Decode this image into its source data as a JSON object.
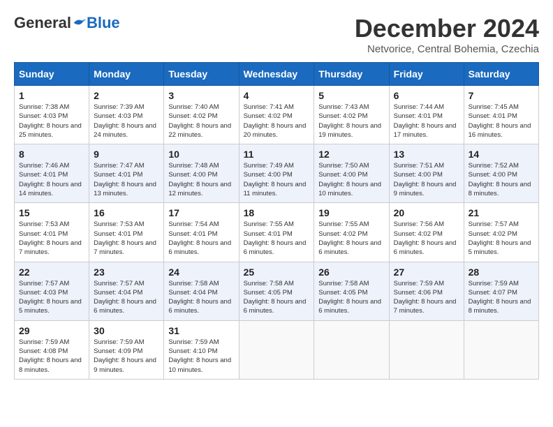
{
  "logo": {
    "general": "General",
    "blue": "Blue"
  },
  "title": "December 2024",
  "subtitle": "Netvorice, Central Bohemia, Czechia",
  "weekdays": [
    "Sunday",
    "Monday",
    "Tuesday",
    "Wednesday",
    "Thursday",
    "Friday",
    "Saturday"
  ],
  "weeks": [
    [
      {
        "day": "1",
        "sunrise": "Sunrise: 7:38 AM",
        "sunset": "Sunset: 4:03 PM",
        "daylight": "Daylight: 8 hours and 25 minutes."
      },
      {
        "day": "2",
        "sunrise": "Sunrise: 7:39 AM",
        "sunset": "Sunset: 4:03 PM",
        "daylight": "Daylight: 8 hours and 24 minutes."
      },
      {
        "day": "3",
        "sunrise": "Sunrise: 7:40 AM",
        "sunset": "Sunset: 4:02 PM",
        "daylight": "Daylight: 8 hours and 22 minutes."
      },
      {
        "day": "4",
        "sunrise": "Sunrise: 7:41 AM",
        "sunset": "Sunset: 4:02 PM",
        "daylight": "Daylight: 8 hours and 20 minutes."
      },
      {
        "day": "5",
        "sunrise": "Sunrise: 7:43 AM",
        "sunset": "Sunset: 4:02 PM",
        "daylight": "Daylight: 8 hours and 19 minutes."
      },
      {
        "day": "6",
        "sunrise": "Sunrise: 7:44 AM",
        "sunset": "Sunset: 4:01 PM",
        "daylight": "Daylight: 8 hours and 17 minutes."
      },
      {
        "day": "7",
        "sunrise": "Sunrise: 7:45 AM",
        "sunset": "Sunset: 4:01 PM",
        "daylight": "Daylight: 8 hours and 16 minutes."
      }
    ],
    [
      {
        "day": "8",
        "sunrise": "Sunrise: 7:46 AM",
        "sunset": "Sunset: 4:01 PM",
        "daylight": "Daylight: 8 hours and 14 minutes."
      },
      {
        "day": "9",
        "sunrise": "Sunrise: 7:47 AM",
        "sunset": "Sunset: 4:01 PM",
        "daylight": "Daylight: 8 hours and 13 minutes."
      },
      {
        "day": "10",
        "sunrise": "Sunrise: 7:48 AM",
        "sunset": "Sunset: 4:00 PM",
        "daylight": "Daylight: 8 hours and 12 minutes."
      },
      {
        "day": "11",
        "sunrise": "Sunrise: 7:49 AM",
        "sunset": "Sunset: 4:00 PM",
        "daylight": "Daylight: 8 hours and 11 minutes."
      },
      {
        "day": "12",
        "sunrise": "Sunrise: 7:50 AM",
        "sunset": "Sunset: 4:00 PM",
        "daylight": "Daylight: 8 hours and 10 minutes."
      },
      {
        "day": "13",
        "sunrise": "Sunrise: 7:51 AM",
        "sunset": "Sunset: 4:00 PM",
        "daylight": "Daylight: 8 hours and 9 minutes."
      },
      {
        "day": "14",
        "sunrise": "Sunrise: 7:52 AM",
        "sunset": "Sunset: 4:00 PM",
        "daylight": "Daylight: 8 hours and 8 minutes."
      }
    ],
    [
      {
        "day": "15",
        "sunrise": "Sunrise: 7:53 AM",
        "sunset": "Sunset: 4:01 PM",
        "daylight": "Daylight: 8 hours and 7 minutes."
      },
      {
        "day": "16",
        "sunrise": "Sunrise: 7:53 AM",
        "sunset": "Sunset: 4:01 PM",
        "daylight": "Daylight: 8 hours and 7 minutes."
      },
      {
        "day": "17",
        "sunrise": "Sunrise: 7:54 AM",
        "sunset": "Sunset: 4:01 PM",
        "daylight": "Daylight: 8 hours and 6 minutes."
      },
      {
        "day": "18",
        "sunrise": "Sunrise: 7:55 AM",
        "sunset": "Sunset: 4:01 PM",
        "daylight": "Daylight: 8 hours and 6 minutes."
      },
      {
        "day": "19",
        "sunrise": "Sunrise: 7:55 AM",
        "sunset": "Sunset: 4:02 PM",
        "daylight": "Daylight: 8 hours and 6 minutes."
      },
      {
        "day": "20",
        "sunrise": "Sunrise: 7:56 AM",
        "sunset": "Sunset: 4:02 PM",
        "daylight": "Daylight: 8 hours and 6 minutes."
      },
      {
        "day": "21",
        "sunrise": "Sunrise: 7:57 AM",
        "sunset": "Sunset: 4:02 PM",
        "daylight": "Daylight: 8 hours and 5 minutes."
      }
    ],
    [
      {
        "day": "22",
        "sunrise": "Sunrise: 7:57 AM",
        "sunset": "Sunset: 4:03 PM",
        "daylight": "Daylight: 8 hours and 5 minutes."
      },
      {
        "day": "23",
        "sunrise": "Sunrise: 7:57 AM",
        "sunset": "Sunset: 4:04 PM",
        "daylight": "Daylight: 8 hours and 6 minutes."
      },
      {
        "day": "24",
        "sunrise": "Sunrise: 7:58 AM",
        "sunset": "Sunset: 4:04 PM",
        "daylight": "Daylight: 8 hours and 6 minutes."
      },
      {
        "day": "25",
        "sunrise": "Sunrise: 7:58 AM",
        "sunset": "Sunset: 4:05 PM",
        "daylight": "Daylight: 8 hours and 6 minutes."
      },
      {
        "day": "26",
        "sunrise": "Sunrise: 7:58 AM",
        "sunset": "Sunset: 4:05 PM",
        "daylight": "Daylight: 8 hours and 6 minutes."
      },
      {
        "day": "27",
        "sunrise": "Sunrise: 7:59 AM",
        "sunset": "Sunset: 4:06 PM",
        "daylight": "Daylight: 8 hours and 7 minutes."
      },
      {
        "day": "28",
        "sunrise": "Sunrise: 7:59 AM",
        "sunset": "Sunset: 4:07 PM",
        "daylight": "Daylight: 8 hours and 8 minutes."
      }
    ],
    [
      {
        "day": "29",
        "sunrise": "Sunrise: 7:59 AM",
        "sunset": "Sunset: 4:08 PM",
        "daylight": "Daylight: 8 hours and 8 minutes."
      },
      {
        "day": "30",
        "sunrise": "Sunrise: 7:59 AM",
        "sunset": "Sunset: 4:09 PM",
        "daylight": "Daylight: 8 hours and 9 minutes."
      },
      {
        "day": "31",
        "sunrise": "Sunrise: 7:59 AM",
        "sunset": "Sunset: 4:10 PM",
        "daylight": "Daylight: 8 hours and 10 minutes."
      },
      null,
      null,
      null,
      null
    ]
  ]
}
